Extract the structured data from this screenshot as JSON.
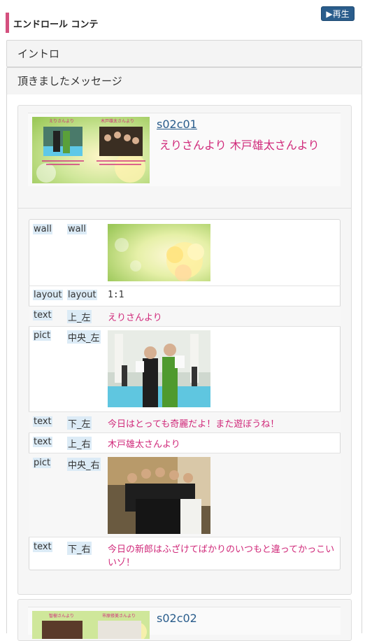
{
  "header": {
    "title": "エンドロール コンテ",
    "play_label": "▶再生"
  },
  "panels": [
    {
      "label": "イントロ"
    },
    {
      "label": "頂きましたメッセージ"
    }
  ],
  "scenes": [
    {
      "code": "s02c01",
      "message": "えりさんより 木戸雄太さんより",
      "thumb_texts": [
        "えりさんより",
        "木戸雄太さんより"
      ],
      "rows": [
        {
          "type": "wall",
          "pos": "wall",
          "kind": "image",
          "alt": "flower-wallpaper"
        },
        {
          "type": "layout",
          "pos": "layout",
          "kind": "mono",
          "value": "1:1"
        },
        {
          "type": "text",
          "pos": "上_左",
          "kind": "text",
          "value": "えりさんより"
        },
        {
          "type": "pict",
          "pos": "中央_左",
          "kind": "image",
          "alt": "two-women-photo"
        },
        {
          "type": "text",
          "pos": "下_左",
          "kind": "text",
          "value": "今日はとっても奇麗だよ！また遊ぼうね！"
        },
        {
          "type": "text",
          "pos": "上_右",
          "kind": "text",
          "value": "木戸雄太さんより"
        },
        {
          "type": "pict",
          "pos": "中央_右",
          "kind": "image",
          "alt": "group-photo"
        },
        {
          "type": "text",
          "pos": "下_右",
          "kind": "text",
          "value": "今日の新郎はふざけてばかりのいつもと違ってかっこい",
          "value2": "いゾ！"
        }
      ]
    },
    {
      "code": "s02c02",
      "thumb_texts": [
        "智樹さんより",
        "市原修美さんより"
      ]
    }
  ],
  "colors": {
    "accent_pink": "#d0297a",
    "link_blue": "#2a5d8c",
    "header_bar": "#d4507e"
  }
}
